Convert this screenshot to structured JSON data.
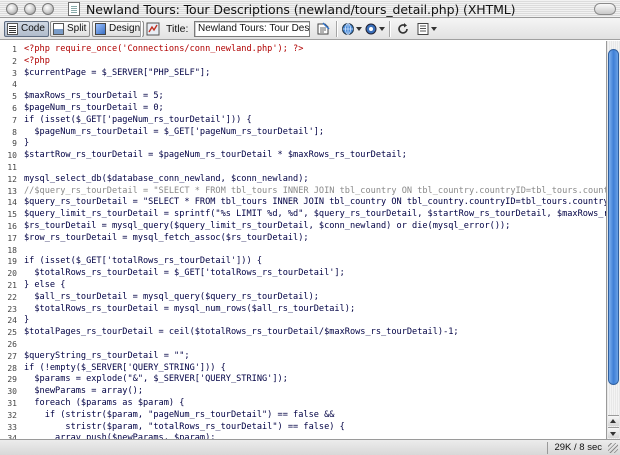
{
  "window": {
    "title": "Newland Tours: Tour Descriptions (newland/tours_detail.php) (XHTML)"
  },
  "toolbar": {
    "code_label": "Code",
    "split_label": "Split",
    "design_label": "Design",
    "title_label": "Title:",
    "title_value": "Newland Tours: Tour Descri"
  },
  "code_lines": [
    {
      "n": "1",
      "text": "<?php require_once('Connections/conn_newland.php'); ?>",
      "kind": "tag"
    },
    {
      "n": "2",
      "text": "<?php",
      "kind": "tag"
    },
    {
      "n": "3",
      "text": "$currentPage = $_SERVER[\"PHP_SELF\"];",
      "kind": "code"
    },
    {
      "n": "4",
      "text": "",
      "kind": "code"
    },
    {
      "n": "5",
      "text": "$maxRows_rs_tourDetail = 5;",
      "kind": "code"
    },
    {
      "n": "6",
      "text": "$pageNum_rs_tourDetail = 0;",
      "kind": "code"
    },
    {
      "n": "7",
      "text": "if (isset($_GET['pageNum_rs_tourDetail'])) {",
      "kind": "code"
    },
    {
      "n": "8",
      "text": "  $pageNum_rs_tourDetail = $_GET['pageNum_rs_tourDetail'];",
      "kind": "code"
    },
    {
      "n": "9",
      "text": "}",
      "kind": "code"
    },
    {
      "n": "10",
      "text": "$startRow_rs_tourDetail = $pageNum_rs_tourDetail * $maxRows_rs_tourDetail;",
      "kind": "code"
    },
    {
      "n": "11",
      "text": "",
      "kind": "code"
    },
    {
      "n": "12",
      "text": "mysql_select_db($database_conn_newland, $conn_newland);",
      "kind": "code"
    },
    {
      "n": "13",
      "text": "//$query_rs_tourDetail = \"SELECT * FROM tbl_tours INNER JOIN tbl_country ON tbl_country.countryID=tbl_tours.country ORDER BY tbl_",
      "kind": "cmt"
    },
    {
      "n": "14",
      "text": "$query_rs_tourDetail = \"SELECT * FROM tbl_tours INNER JOIN tbl_country ON tbl_country.countryID=tbl_tours.country ORDER BY tbl_",
      "kind": "code"
    },
    {
      "n": "15",
      "text": "$query_limit_rs_tourDetail = sprintf(\"%s LIMIT %d, %d\", $query_rs_tourDetail, $startRow_rs_tourDetail, $maxRows_rs_tourDetail);",
      "kind": "code"
    },
    {
      "n": "16",
      "text": "$rs_tourDetail = mysql_query($query_limit_rs_tourDetail, $conn_newland) or die(mysql_error());",
      "kind": "code"
    },
    {
      "n": "17",
      "text": "$row_rs_tourDetail = mysql_fetch_assoc($rs_tourDetail);",
      "kind": "code"
    },
    {
      "n": "18",
      "text": "",
      "kind": "code"
    },
    {
      "n": "19",
      "text": "if (isset($_GET['totalRows_rs_tourDetail'])) {",
      "kind": "code"
    },
    {
      "n": "20",
      "text": "  $totalRows_rs_tourDetail = $_GET['totalRows_rs_tourDetail'];",
      "kind": "code"
    },
    {
      "n": "21",
      "text": "} else {",
      "kind": "code"
    },
    {
      "n": "22",
      "text": "  $all_rs_tourDetail = mysql_query($query_rs_tourDetail);",
      "kind": "code"
    },
    {
      "n": "23",
      "text": "  $totalRows_rs_tourDetail = mysql_num_rows($all_rs_tourDetail);",
      "kind": "code"
    },
    {
      "n": "24",
      "text": "}",
      "kind": "code"
    },
    {
      "n": "25",
      "text": "$totalPages_rs_tourDetail = ceil($totalRows_rs_tourDetail/$maxRows_rs_tourDetail)-1;",
      "kind": "code"
    },
    {
      "n": "26",
      "text": "",
      "kind": "code"
    },
    {
      "n": "27",
      "text": "$queryString_rs_tourDetail = \"\";",
      "kind": "code"
    },
    {
      "n": "28",
      "text": "if (!empty($_SERVER['QUERY_STRING'])) {",
      "kind": "code"
    },
    {
      "n": "29",
      "text": "  $params = explode(\"&\", $_SERVER['QUERY_STRING']);",
      "kind": "code"
    },
    {
      "n": "30",
      "text": "  $newParams = array();",
      "kind": "code"
    },
    {
      "n": "31",
      "text": "  foreach ($params as $param) {",
      "kind": "code"
    },
    {
      "n": "32",
      "text": "    if (stristr($param, \"pageNum_rs_tourDetail\") == false &&",
      "kind": "code"
    },
    {
      "n": "33",
      "text": "        stristr($param, \"totalRows_rs_tourDetail\") == false) {",
      "kind": "code"
    },
    {
      "n": "34",
      "text": "      array_push($newParams, $param);",
      "kind": "code"
    }
  ],
  "status": {
    "size_time": "29K / 8 sec"
  },
  "colors": {
    "tag": "#b00000",
    "code": "#000044",
    "comment": "#8a8a8a",
    "scroll_thumb": "#3d7fd6"
  },
  "icons": [
    "document-icon",
    "code-view-icon",
    "split-view-icon",
    "design-view-icon",
    "file-management-icon",
    "preview-globe-icon",
    "refresh-icon",
    "view-options-icon",
    "validate-icon"
  ]
}
